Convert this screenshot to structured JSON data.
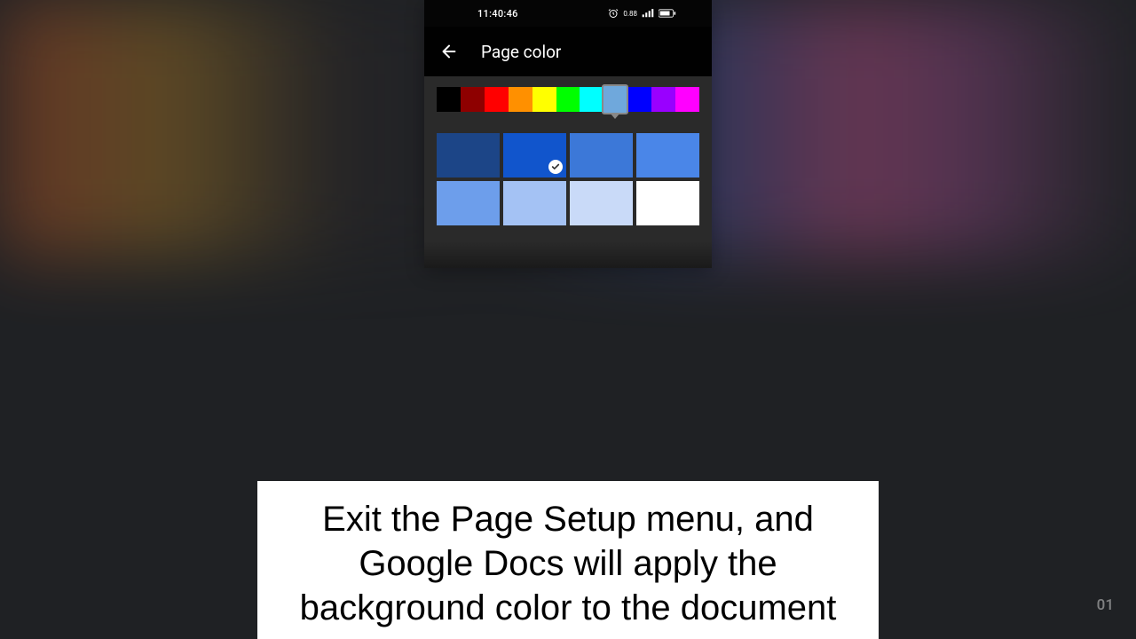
{
  "status": {
    "time": "11:40:46",
    "indicators": "⏰ 📶 📶 🔋"
  },
  "header": {
    "title": "Page color"
  },
  "color_strip": {
    "colors": [
      "#000000",
      "#8e0000",
      "#ff0000",
      "#ff9000",
      "#ffff00",
      "#00ff00",
      "#00ffff",
      "#6fa8dc",
      "#0000ff",
      "#9900ff",
      "#ff00ff"
    ],
    "selected_index": 7
  },
  "shades": [
    {
      "color": "#1c4587",
      "selected": false
    },
    {
      "color": "#1155cc",
      "selected": true
    },
    {
      "color": "#3c78d8",
      "selected": false
    },
    {
      "color": "#4a86e8",
      "selected": false
    },
    {
      "color": "#6d9eeb",
      "selected": false
    },
    {
      "color": "#a4c2f4",
      "selected": false
    },
    {
      "color": "#c9daf8",
      "selected": false
    },
    {
      "color": "#ffffff",
      "selected": false
    }
  ],
  "caption": "Exit the Page Setup menu, and Google Docs will apply the background color to the document",
  "corner_timestamp": "01"
}
